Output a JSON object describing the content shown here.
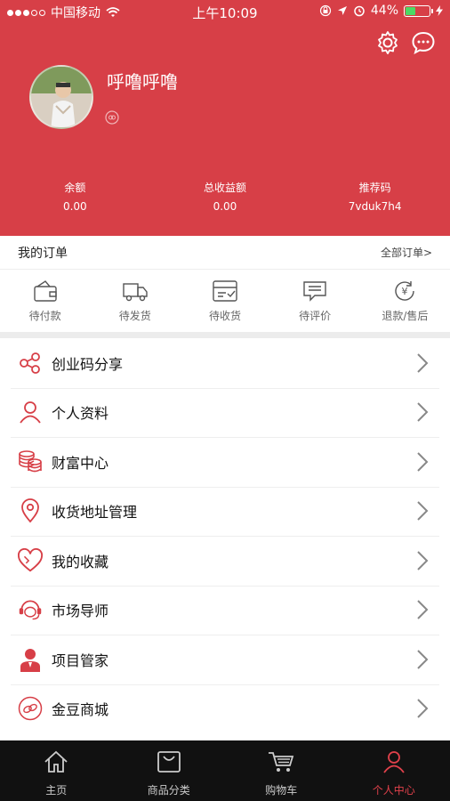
{
  "status_bar": {
    "carrier": "中国移动",
    "time": "上午10:09",
    "battery_percent": "44%",
    "battery_level": 0.44
  },
  "header": {
    "username": "呼噜呼噜",
    "stats": [
      {
        "label": "余额",
        "value": "0.00"
      },
      {
        "label": "总收益额",
        "value": "0.00"
      },
      {
        "label": "推荐码",
        "value": "7vduk7h4"
      }
    ]
  },
  "orders": {
    "title": "我的订单",
    "all_link": "全部订单>",
    "items": [
      {
        "label": "待付款",
        "icon": "wallet-icon"
      },
      {
        "label": "待发货",
        "icon": "truck-icon"
      },
      {
        "label": "待收货",
        "icon": "inbox-icon"
      },
      {
        "label": "待评价",
        "icon": "comment-icon"
      },
      {
        "label": "退款/售后",
        "icon": "refund-icon"
      }
    ]
  },
  "menu": [
    {
      "label": "创业码分享",
      "icon": "share-icon"
    },
    {
      "label": "个人资料",
      "icon": "user-icon"
    },
    {
      "label": "财富中心",
      "icon": "coins-icon"
    },
    {
      "label": "收货地址管理",
      "icon": "location-icon"
    },
    {
      "label": "我的收藏",
      "icon": "heart-icon"
    },
    {
      "label": "市场导师",
      "icon": "headset-icon"
    },
    {
      "label": "项目管家",
      "icon": "manager-icon"
    },
    {
      "label": "金豆商城",
      "icon": "beans-icon"
    }
  ],
  "tabbar": [
    {
      "label": "主页",
      "icon": "home-icon"
    },
    {
      "label": "商品分类",
      "icon": "bag-icon"
    },
    {
      "label": "购物车",
      "icon": "cart-icon"
    },
    {
      "label": "个人中心",
      "icon": "person-icon",
      "active": true
    }
  ],
  "colors": {
    "brand": "#d73f47",
    "active_tab": "#e0414b",
    "tabbar_bg": "#111111"
  }
}
